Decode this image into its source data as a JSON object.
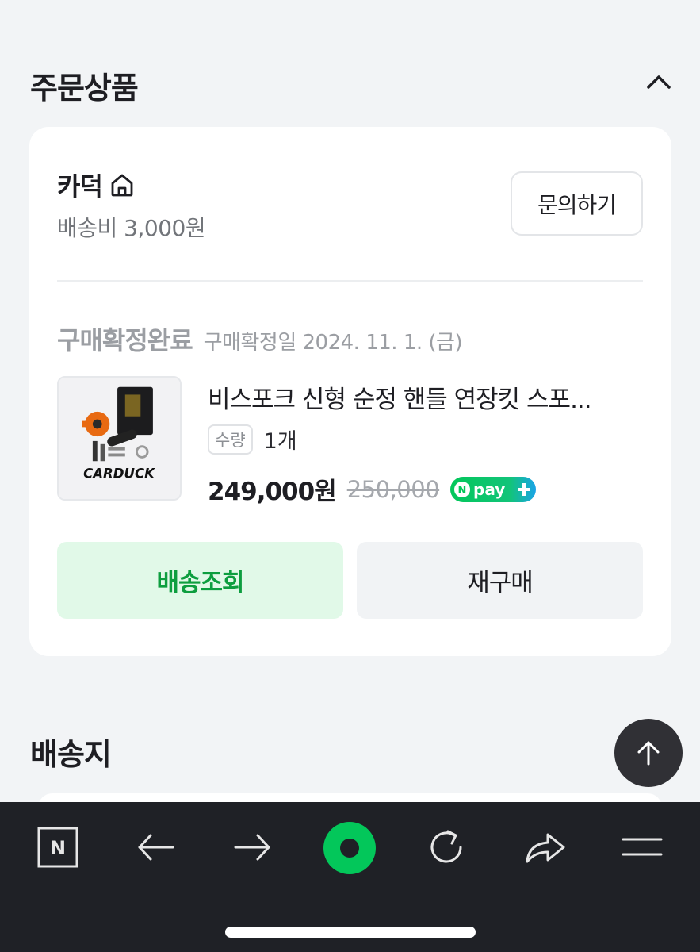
{
  "order_section": {
    "title": "주문상품",
    "seller": {
      "name": "카덕",
      "shipping_fee": "배송비 3,000원",
      "inquiry_label": "문의하기"
    },
    "order_item": {
      "status": "구매확정완료",
      "status_date": "구매확정일 2024. 11. 1. (금)",
      "product_name": "비스포크 신형 순정 핸들 연장킷 스포...",
      "thumbnail_brand": "CARDUCK",
      "quantity_label": "수량",
      "quantity_value": "1개",
      "price": "249,000원",
      "original_price": "250,000",
      "payment_badge": "pay"
    },
    "actions": {
      "track_label": "배송조회",
      "rebuy_label": "재구매"
    }
  },
  "delivery_section": {
    "title": "배송지"
  },
  "colors": {
    "background": "#f2f4f6",
    "accent_green": "#0d9e3f",
    "track_button_bg": "#e1f9e8",
    "bottom_bar": "#1f2126",
    "naver_green": "#03c75a"
  },
  "icons": [
    "chevron-up-icon",
    "home-icon",
    "npay-icon",
    "arrow-up-icon",
    "naver-n-icon",
    "back-arrow-icon",
    "forward-arrow-icon",
    "green-dot-icon",
    "refresh-icon",
    "share-icon",
    "menu-icon"
  ]
}
